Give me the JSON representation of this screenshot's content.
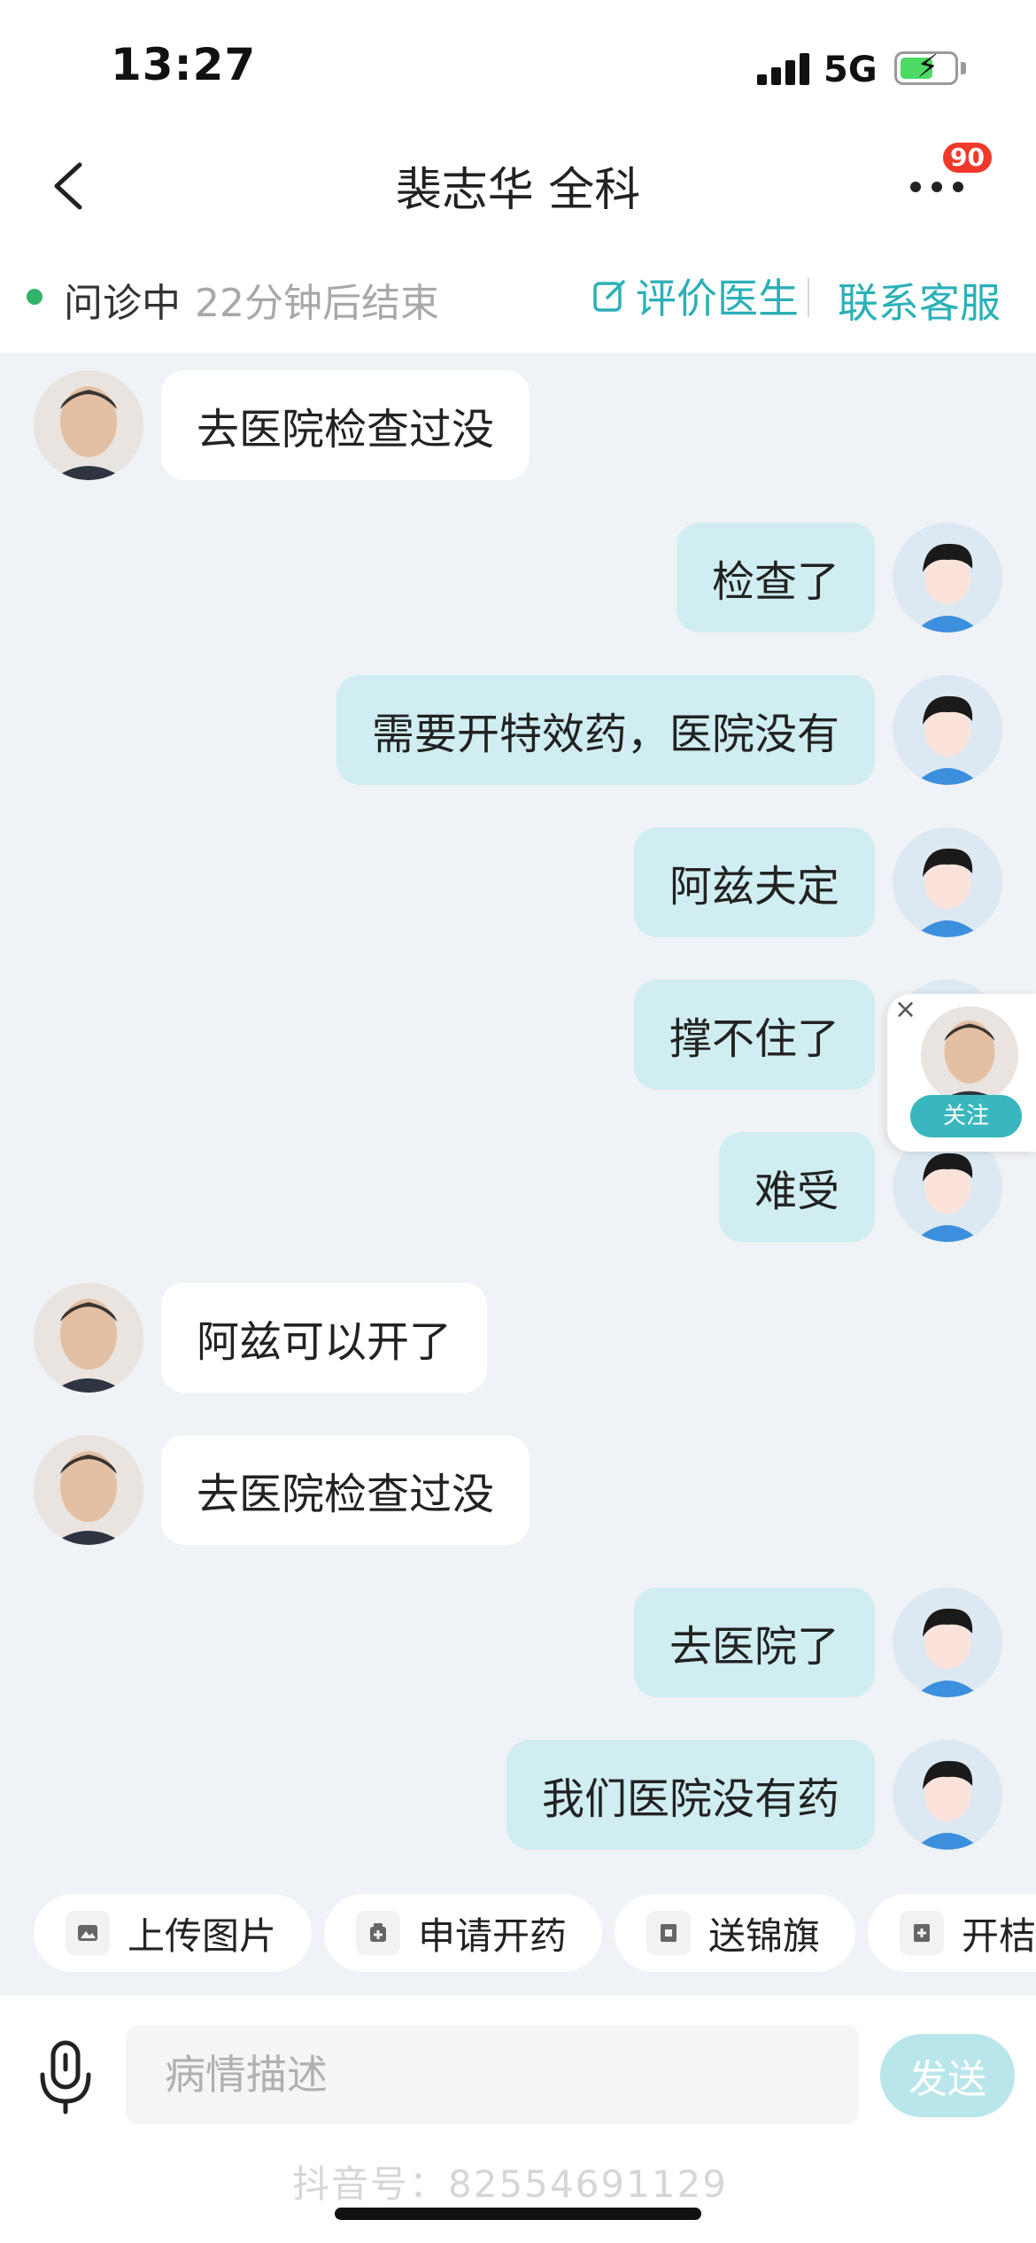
{
  "status_bar": {
    "time": "13:27",
    "network": "5G"
  },
  "header": {
    "title": "裴志华 全科",
    "notification_count": "90"
  },
  "consult": {
    "status": "问诊中",
    "time_remaining": "22分钟后结束",
    "rate_label": "评价医生",
    "service_label": "联系客服"
  },
  "messages": [
    {
      "sender": "doctor",
      "text": "去医院检查过没"
    },
    {
      "sender": "user",
      "text": "检查了"
    },
    {
      "sender": "user",
      "text": "需要开特效药，医院没有"
    },
    {
      "sender": "user",
      "text": "阿兹夫定"
    },
    {
      "sender": "user",
      "text": "撑不住了"
    },
    {
      "sender": "user",
      "text": "难受"
    },
    {
      "sender": "doctor",
      "text": "阿兹可以开了"
    },
    {
      "sender": "doctor",
      "text": "去医院检查过没"
    },
    {
      "sender": "user",
      "text": "去医院了"
    },
    {
      "sender": "user",
      "text": "我们医院没有药"
    }
  ],
  "follow_card": {
    "close": "×",
    "button": "关注"
  },
  "quick_actions": [
    {
      "label": "上传图片",
      "icon": "image-icon"
    },
    {
      "label": "申请开药",
      "icon": "medicine-icon"
    },
    {
      "label": "送锦旗",
      "icon": "banner-icon"
    },
    {
      "label": "开桔",
      "icon": "plus-doc-icon"
    }
  ],
  "composer": {
    "placeholder": "病情描述",
    "send_label": "发送"
  },
  "watermark": "抖音号：82554691129",
  "colors": {
    "accent": "#2bb0b7",
    "user_bubble": "#d0eef1",
    "badge": "#f0392b",
    "online": "#34b36a"
  }
}
